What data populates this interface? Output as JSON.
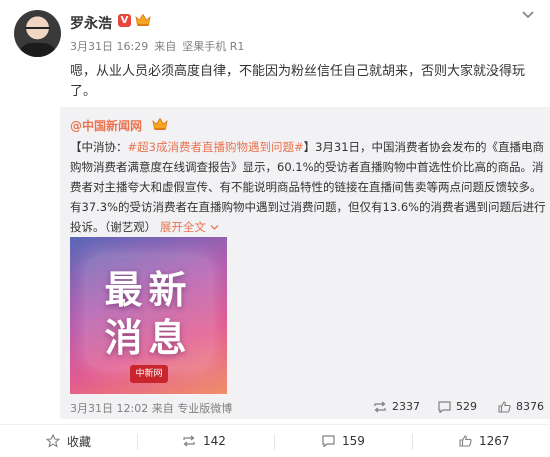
{
  "post": {
    "author": "罗永浩",
    "verified_mark": "V",
    "date": "3月31日 16:29",
    "source_prefix": "来自",
    "source": "坚果手机 R1",
    "text": "嗯，从业人员必须高度自律，不能因为粉丝信任自己就胡来，否则大家就没得玩了。"
  },
  "repost": {
    "author": "@中国新闻网",
    "text_prefix": "【中消协：",
    "hashtag": "#超3成消费者直播购物遇到问题#",
    "text_body": "】3月31日，中国消费者协会发布的《直播电商购物消费者满意度在线调查报告》显示，60.1%的受访者直播购物中首选性价比高的商品。消费者对主播夸大和虚假宣传、有不能说明商品特性的链接在直播间售卖等两点问题反馈较多。有37.3%的受访消费者在直播购物中遇到过消费问题，但仅有13.6%的消费者遇到问题后进行投诉。（谢艺观）",
    "expand_label": "展开全文",
    "image_text_line1": "最新",
    "image_text_line2": "消息",
    "image_logo_text": "中新网",
    "date": "3月31日 12:02",
    "source_prefix": "来自",
    "source": "专业版微博",
    "reposts": "2337",
    "comments": "529",
    "likes": "8376"
  },
  "actions": {
    "favorite": "收藏",
    "repost": "142",
    "comment": "159",
    "like": "1267"
  },
  "colors": {
    "accent": "#eb7350",
    "verified": "#e8483c",
    "muted": "#808080"
  },
  "icons": {
    "verified": "verified-v-icon",
    "vip": "crown-icon",
    "more": "chevron-down-icon",
    "repost": "repost-icon",
    "comment": "comment-icon",
    "like": "thumbs-up-icon",
    "favorite": "star-icon"
  }
}
